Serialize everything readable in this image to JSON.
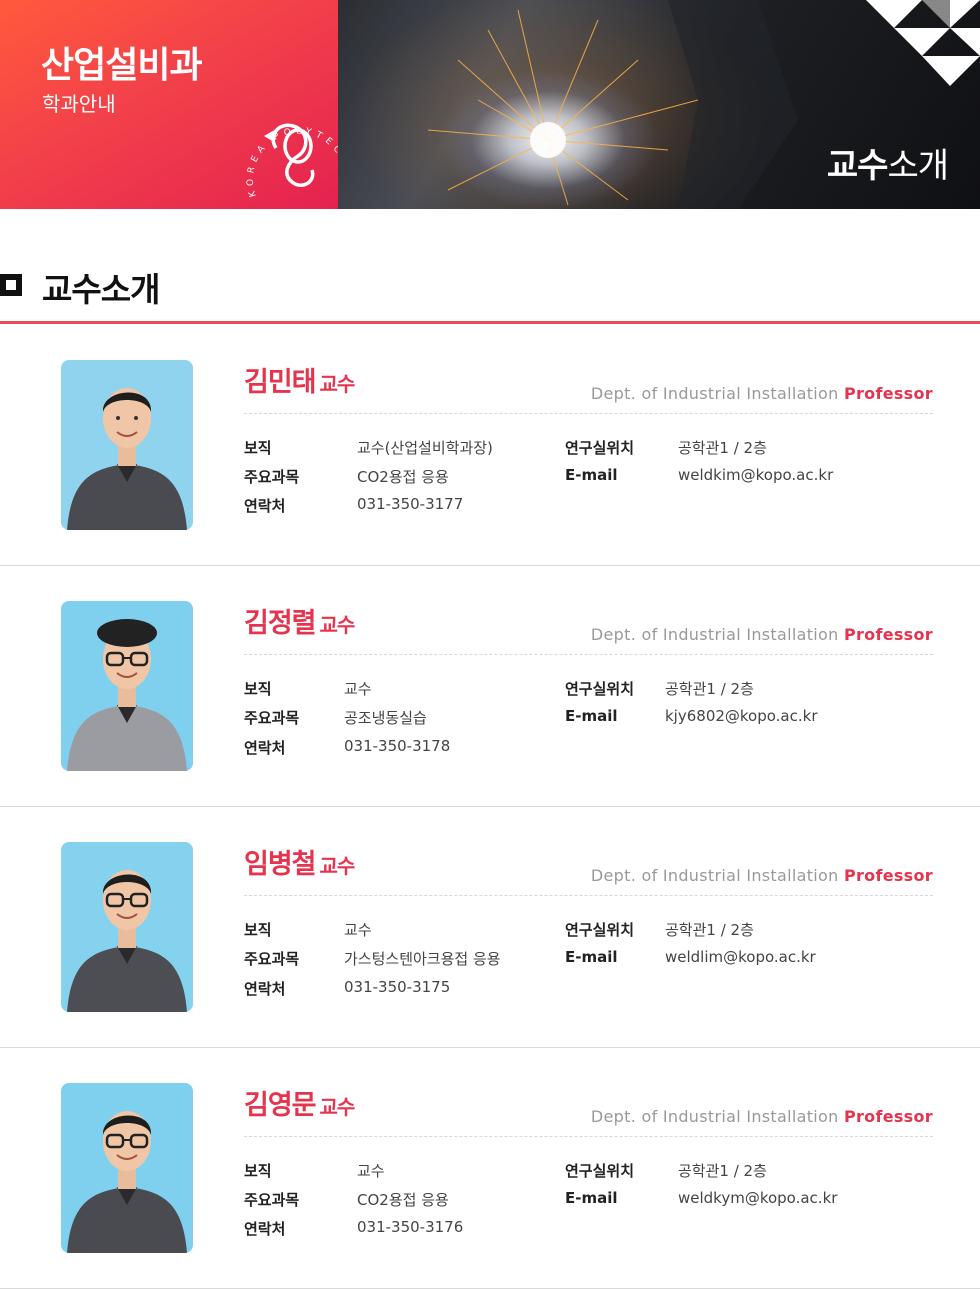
{
  "banner": {
    "department": "산업설비과",
    "subtitle": "학과안내",
    "caption_bold": "교수",
    "caption_rest": "소개",
    "accent_color": "#ec3650"
  },
  "section": {
    "title": "교수소개"
  },
  "labels": {
    "position": "보직",
    "subjects": "주요과목",
    "contact": "연락처",
    "office": "연구실위치",
    "email": "E-mail",
    "title_suffix": "교수",
    "dept_text": "Dept. of  Industrial Installation",
    "dept_role": "Professor"
  },
  "professors": [
    {
      "name": "김민태",
      "position": "교수(산업설비학과장)",
      "subjects": "CO2용접 응용",
      "contact": "031-350-3177",
      "office": "공학관1 / 2층",
      "email": "weldkim@kopo.ac.kr"
    },
    {
      "name": "김정렬",
      "position": "교수",
      "subjects": "공조냉동실습",
      "contact": "031-350-3178",
      "office": "공학관1 / 2층",
      "email": "kjy6802@kopo.ac.kr"
    },
    {
      "name": "임병철",
      "position": "교수",
      "subjects": "가스텅스텐아크용접 응용",
      "contact": "031-350-3175",
      "office": "공학관1 / 2층",
      "email": "weldlim@kopo.ac.kr"
    },
    {
      "name": "김영문",
      "position": "교수",
      "subjects": "CO2용접 응용",
      "contact": "031-350-3176",
      "office": "공학관1 / 2층",
      "email": "weldkym@kopo.ac.kr"
    }
  ]
}
